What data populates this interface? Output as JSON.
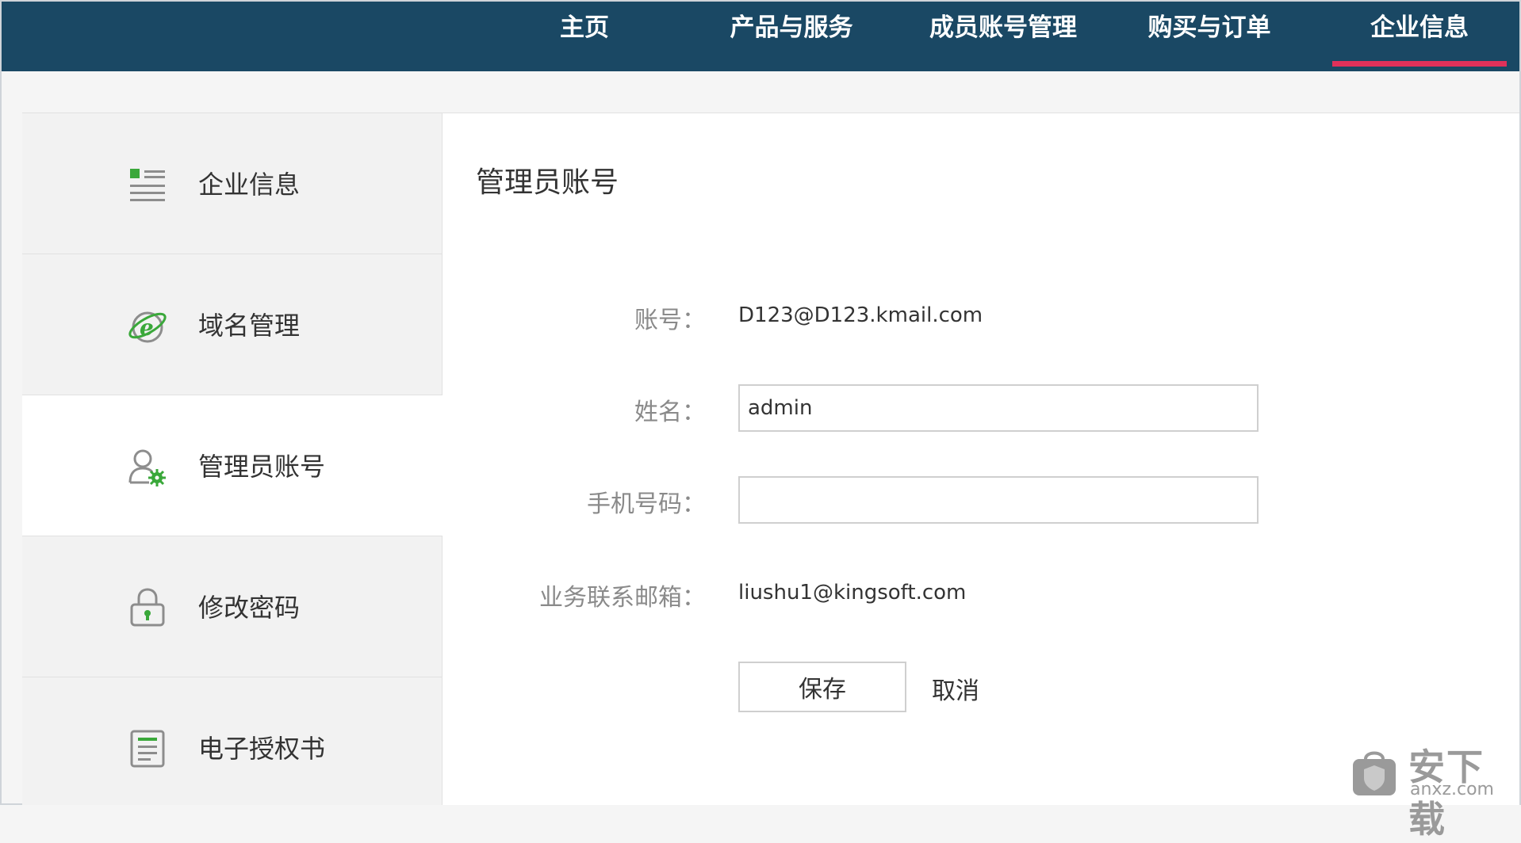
{
  "topnav": {
    "items": [
      {
        "label": "主页"
      },
      {
        "label": "产品与服务"
      },
      {
        "label": "成员账号管理"
      },
      {
        "label": "购买与订单"
      },
      {
        "label": "企业信息",
        "active": true
      }
    ],
    "accent_color": "#e0315a",
    "background_color": "#1a4864"
  },
  "sidebar": {
    "items": [
      {
        "label": "企业信息",
        "icon": "list-icon"
      },
      {
        "label": "域名管理",
        "icon": "ie-globe-icon"
      },
      {
        "label": "管理员账号",
        "icon": "user-gear-icon",
        "active": true
      },
      {
        "label": "修改密码",
        "icon": "lock-icon"
      },
      {
        "label": "电子授权书",
        "icon": "document-icon"
      }
    ]
  },
  "main": {
    "title": "管理员账号",
    "account": {
      "label": "账号：",
      "value": "D123@D123.kmail.com"
    },
    "name": {
      "label": "姓名：",
      "value": "admin"
    },
    "phone": {
      "label": "手机号码：",
      "value": ""
    },
    "business_email": {
      "label": "业务联系邮箱：",
      "value": "liushu1@kingsoft.com"
    },
    "save_label": "保存",
    "cancel_label": "取消"
  },
  "watermark": {
    "brand": "安下载",
    "url": "anxz.com"
  }
}
